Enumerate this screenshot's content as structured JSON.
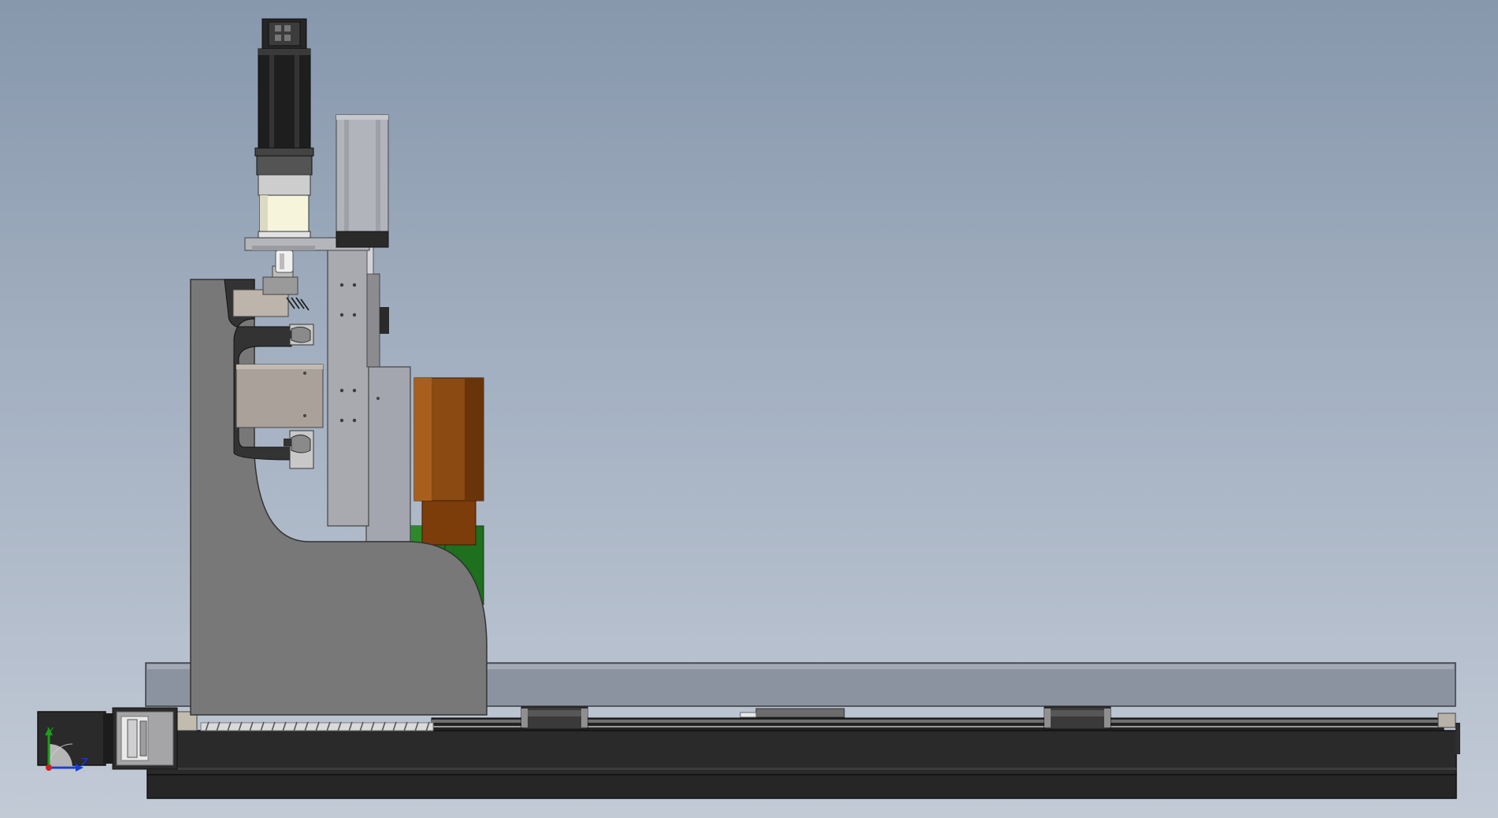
{
  "viewport": {
    "background_top": "#8797ac",
    "background_bottom": "#c2cad6"
  },
  "colors": {
    "motor_black": "#1e1e1e",
    "frame_grey": "#787878",
    "plate_grey": "#a8aab0",
    "copper": "#8a4a12",
    "green_block": "#1e6f1e",
    "cover_grey": "#8c93a0",
    "base_dark": "#2a2a2a"
  },
  "triad": {
    "y_label": "Y",
    "z_label": "Z",
    "y_color": "#1aa01a",
    "z_color": "#1a3fd0"
  }
}
